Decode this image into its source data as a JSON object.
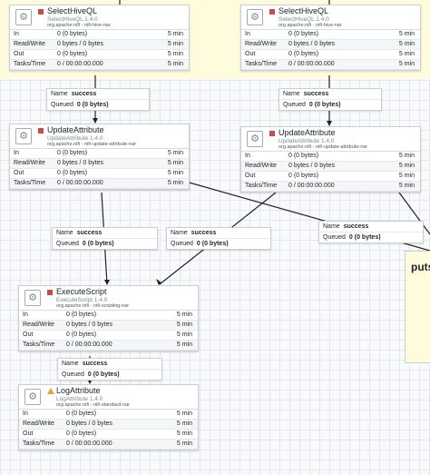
{
  "processors": [
    {
      "id": "p1",
      "name": "SelectHiveQL",
      "type": "SelectHiveQL 1.4.0",
      "bundle": "org.apache.nifi - nifi-hive-nar",
      "icon": "gear-icon",
      "status": "stopped",
      "in": "0 (0 bytes)",
      "rw": "0 bytes / 0 bytes",
      "out": "0 (0 bytes)",
      "tasks": "0 / 00:00:00.000",
      "t_in": "5 min",
      "t_rw": "5 min",
      "t_out": "5 min",
      "t_tasks": "5 min"
    },
    {
      "id": "p2",
      "name": "SelectHiveQL",
      "type": "SelectHiveQL 1.4.0",
      "bundle": "org.apache.nifi - nifi-hive-nar",
      "icon": "gear-icon",
      "status": "stopped",
      "in": "0 (0 bytes)",
      "rw": "0 bytes / 0 bytes",
      "out": "0 (0 bytes)",
      "tasks": "0 / 00:00:00.000",
      "t_in": "5 min",
      "t_rw": "5 min",
      "t_out": "5 min",
      "t_tasks": "5 min"
    },
    {
      "id": "p3",
      "name": "UpdateAttribute",
      "type": "UpdateAttribute 1.4.0",
      "bundle": "org.apache.nifi - nifi-update-attribute-nar",
      "icon": "gear-icon",
      "status": "stopped",
      "in": "0 (0 bytes)",
      "rw": "0 bytes / 0 bytes",
      "out": "0 (0 bytes)",
      "tasks": "0 / 00:00:00.000",
      "t_in": "5 min",
      "t_rw": "5 min",
      "t_out": "5 min",
      "t_tasks": "5 min"
    },
    {
      "id": "p4",
      "name": "UpdateAttribute",
      "type": "UpdateAttribute 1.4.0",
      "bundle": "org.apache.nifi - nifi-update-attribute-nar",
      "icon": "gear-icon",
      "status": "stopped",
      "in": "0 (0 bytes)",
      "rw": "0 bytes / 0 bytes",
      "out": "0 (0 bytes)",
      "tasks": "0 / 00:00:00.000",
      "t_in": "5 min",
      "t_rw": "5 min",
      "t_out": "5 min",
      "t_tasks": "5 min"
    },
    {
      "id": "p5",
      "name": "ExecuteScript",
      "type": "ExecuteScript 1.4.0",
      "bundle": "org.apache.nifi - nifi-scripting-nar",
      "icon": "gear-icon",
      "status": "stopped",
      "in": "0 (0 bytes)",
      "rw": "0 bytes / 0 bytes",
      "out": "0 (0 bytes)",
      "tasks": "0 / 00:00:00.000",
      "t_in": "5 min",
      "t_rw": "5 min",
      "t_out": "5 min",
      "t_tasks": "5 min"
    },
    {
      "id": "p6",
      "name": "LogAttribute",
      "type": "LogAttribute 1.4.0",
      "bundle": "org.apache.nifi - nifi-standard-nar",
      "icon": "gear-icon",
      "status": "invalid",
      "in": "0 (0 bytes)",
      "rw": "0 bytes / 0 bytes",
      "out": "0 (0 bytes)",
      "tasks": "0 / 00:00:00.000",
      "t_in": "5 min",
      "t_rw": "5 min",
      "t_out": "5 min",
      "t_tasks": "5 min"
    }
  ],
  "labels": {
    "in": "In",
    "rw": "Read/Write",
    "out": "Out",
    "tasks": "Tasks/Time",
    "name": "Name",
    "queued": "Queued"
  },
  "connections": [
    {
      "name": "success",
      "queued": "0 (0 bytes)"
    },
    {
      "name": "success",
      "queued": "0 (0 bytes)"
    },
    {
      "name": "success",
      "queued": "0 (0 bytes)"
    },
    {
      "name": "success",
      "queued": "0 (0 bytes)"
    },
    {
      "name": "success",
      "queued": "0 (0 bytes)"
    },
    {
      "name": "success",
      "queued": "0 (0 bytes)"
    }
  ],
  "process_group": {
    "label": "puts"
  },
  "colors": {
    "stopped": "#c84a4a",
    "invalid": "#e3a23b",
    "process_group_bg": "#fffbdd",
    "type_text": "#728e9b"
  }
}
